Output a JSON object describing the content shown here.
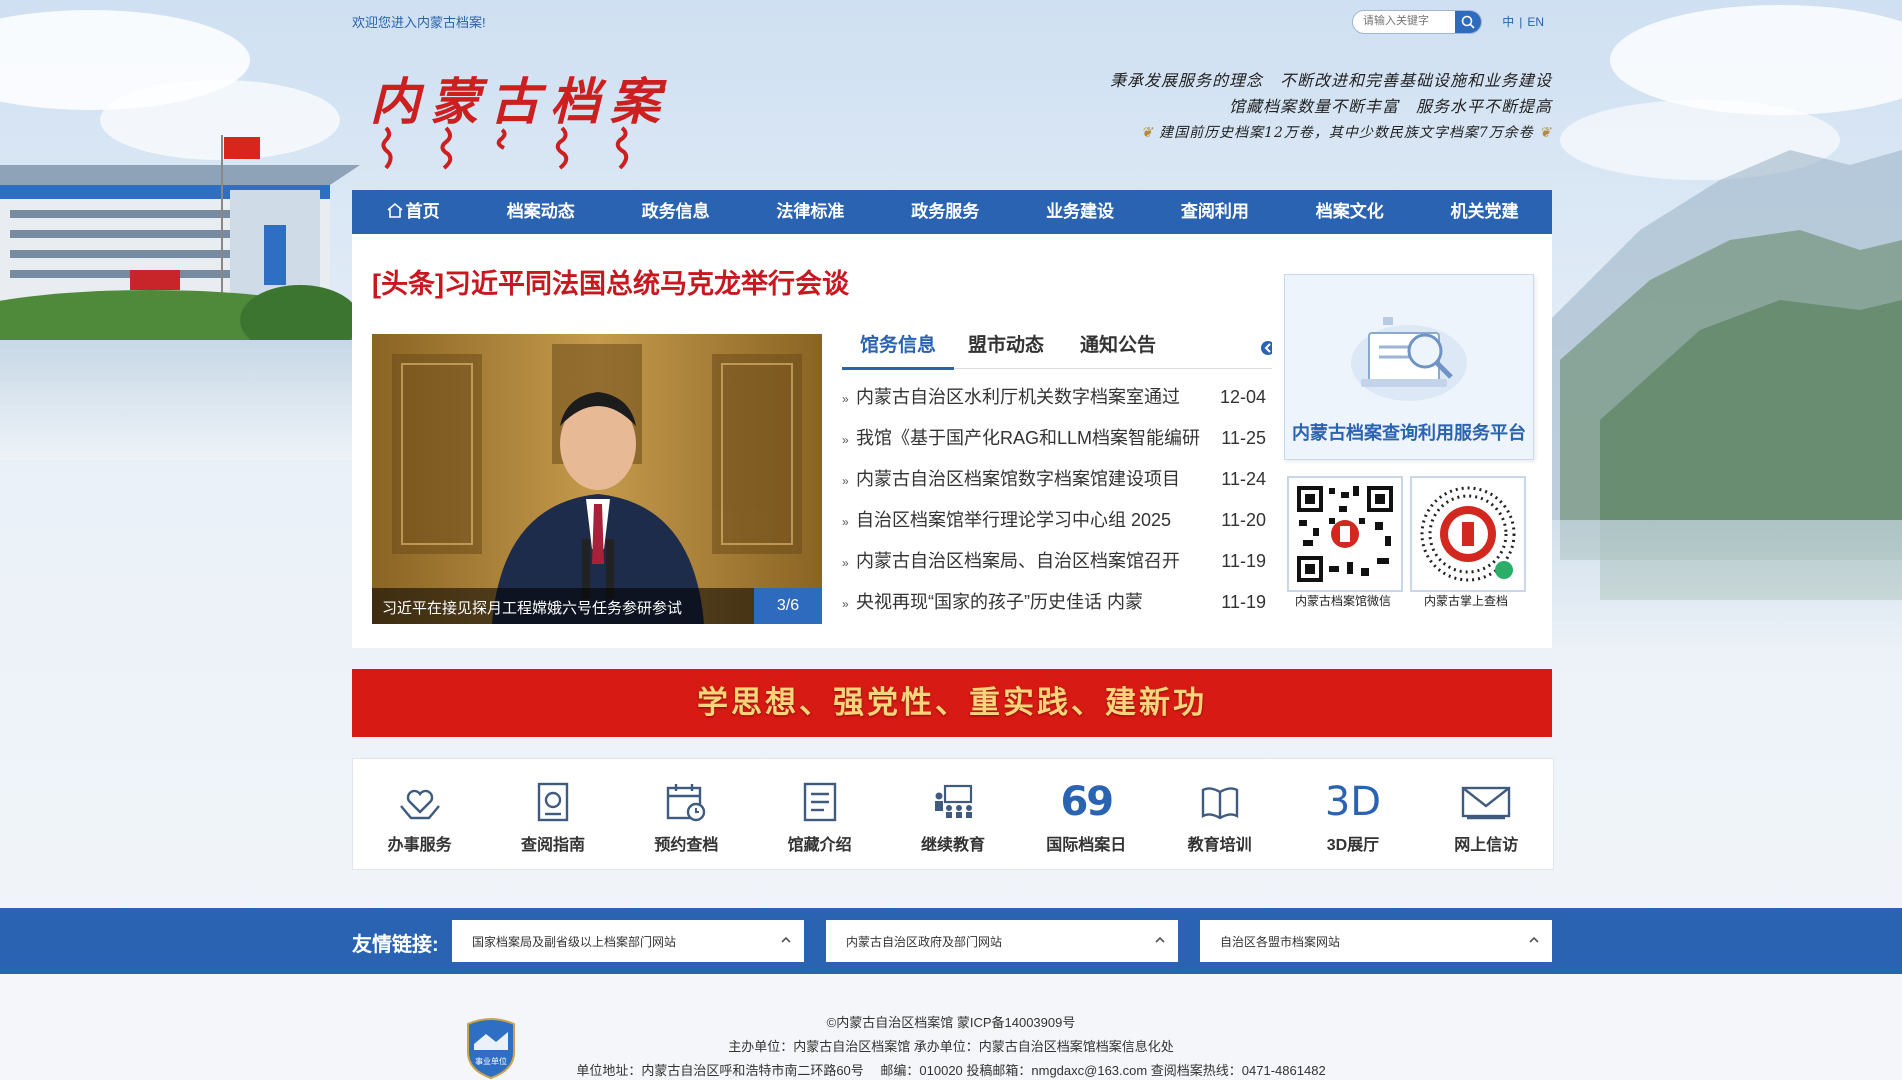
{
  "topbar": {
    "welcome": "欢迎您进入内蒙古档案!",
    "search_placeholder": "请输入关键字",
    "lang_zh": "中",
    "lang_sep": "|",
    "lang_en": "EN"
  },
  "header": {
    "logo_title": "内蒙古档案",
    "slogan_line1": "秉承发展服务的理念　不断改进和完善基础设施和业务建设",
    "slogan_line2": "馆藏档案数量不断丰富　服务水平不断提高",
    "slogan_line3": "建国前历史档案12万卷，其中少数民族文字档案7万余卷"
  },
  "nav": {
    "items": [
      "首页",
      "档案动态",
      "政务信息",
      "法律标准",
      "政务服务",
      "业务建设",
      "查阅利用",
      "档案文化",
      "机关党建"
    ]
  },
  "main": {
    "headline": "[头条]习近平同法国总统马克龙举行会谈",
    "slide_caption": "习近平在接见探月工程嫦娥六号任务参研参试",
    "slide_counter": "3/6",
    "tabs": [
      "馆务信息",
      "盟市动态",
      "通知公告"
    ],
    "news": [
      {
        "title": "内蒙古自治区水利厅机关数字档案室通过",
        "date": "12-04"
      },
      {
        "title": "我馆《基于国产化RAG和LLM档案智能编研",
        "date": "11-25"
      },
      {
        "title": "内蒙古自治区档案馆数字档案馆建设项目",
        "date": "11-24"
      },
      {
        "title": "自治区档案馆举行理论学习中心组 2025",
        "date": "11-20"
      },
      {
        "title": "内蒙古自治区档案局、自治区档案馆召开",
        "date": "11-19"
      },
      {
        "title": "央视再现“国家的孩子”历史佳话 内蒙",
        "date": "11-19"
      }
    ],
    "platform_label": "内蒙古档案查询利用服务平台",
    "qr1_label": "内蒙古档案馆微信",
    "qr2_label": "内蒙古掌上查档"
  },
  "banner": {
    "text": "学思想、强党性、重实践、建新功"
  },
  "services": {
    "items": [
      "办事服务",
      "查阅指南",
      "预约查档",
      "馆藏介绍",
      "继续教育",
      "国际档案日",
      "教育培训",
      "3D展厅",
      "网上信访"
    ],
    "icon_69": "69",
    "icon_3d": "3D"
  },
  "links": {
    "label": "友情链接:",
    "select1": "国家档案局及副省级以上档案部门网站",
    "select2": "内蒙古自治区政府及部门网站",
    "select3": "自治区各盟市档案网站"
  },
  "footer": {
    "line1": "©内蒙古自治区档案馆 蒙ICP备14003909号",
    "line2": "主办单位：内蒙古自治区档案馆 承办单位：内蒙古自治区档案馆档案信息化处",
    "line3": "单位地址：内蒙古自治区呼和浩特市南二环路60号　 邮编：010020 投稿邮箱：nmgdaxc@163.com 查阅档案热线：0471-4861482",
    "badge_text": "事业单位"
  },
  "colors": {
    "primary_blue": "#2a63b2",
    "headline_red": "#c8171f",
    "banner_red": "#d71a13",
    "banner_text_gold": "#f8d57a"
  }
}
